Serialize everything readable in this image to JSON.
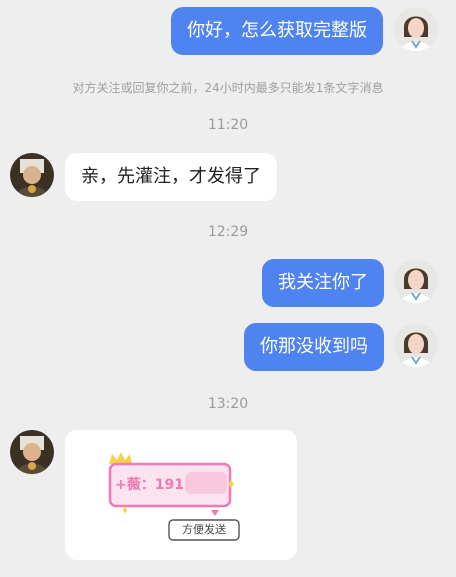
{
  "messages": {
    "m1_text": "你好，怎么获取完整版",
    "notice": "对方关注或回复你之前，24小时内最多只能发1条文字消息",
    "t1": "11:20",
    "m2_text": "亲，先灌注，才发得了",
    "t2": "12:29",
    "m3_text": "我关注你了",
    "m4_text": "你那没收到吗",
    "t3": "13:20"
  },
  "image_card": {
    "contact_prefix": "+薇：",
    "contact_partial": "191",
    "stamp_text": "方便发送"
  },
  "colors": {
    "accent": "#4f83ef",
    "background": "#eeeeef",
    "pink": "#f07ab5",
    "gold": "#f5d24b"
  }
}
